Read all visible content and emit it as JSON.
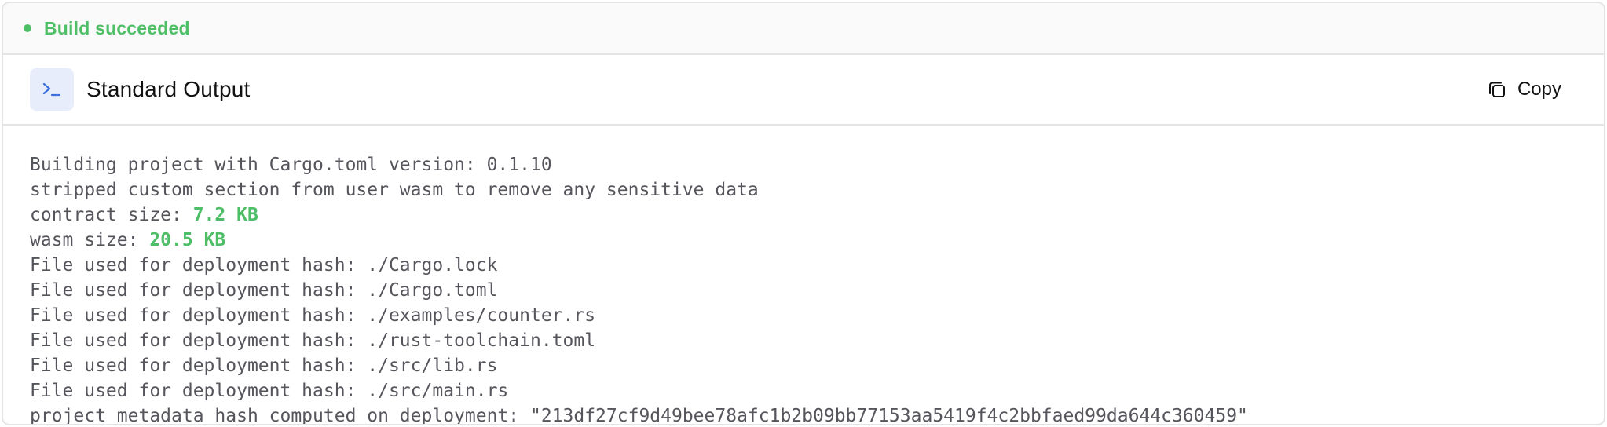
{
  "status": {
    "text": "Build succeeded",
    "color": "#4fbf67"
  },
  "panel": {
    "icon": "terminal-icon",
    "title": "Standard Output",
    "copy_label": "Copy",
    "copy_icon": "copy-icon"
  },
  "output": {
    "line_1": "Building project with Cargo.toml version: 0.1.10",
    "line_2": "stripped custom section from user wasm to remove any sensitive data",
    "line_3_prefix": "contract size: ",
    "line_3_value": "7.2 KB",
    "line_4_prefix": "wasm size: ",
    "line_4_value": "20.5 KB",
    "line_5": "File used for deployment hash: ./Cargo.lock",
    "line_6": "File used for deployment hash: ./Cargo.toml",
    "line_7": "File used for deployment hash: ./examples/counter.rs",
    "line_8": "File used for deployment hash: ./rust-toolchain.toml",
    "line_9": "File used for deployment hash: ./src/lib.rs",
    "line_10": "File used for deployment hash: ./src/main.rs",
    "line_11": "project metadata hash computed on deployment: \"213df27cf9d49bee78afc1b2b09bb77153aa5419f4c2bbfaed99da644c360459\""
  }
}
